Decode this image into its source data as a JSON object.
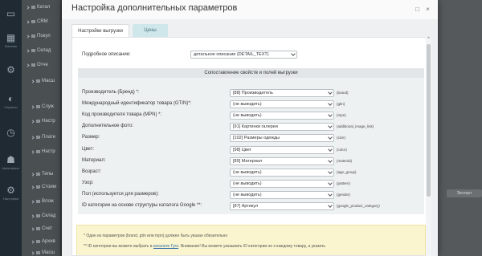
{
  "background": {
    "sidebar_items": [
      {
        "icon": "desktop-icon",
        "glyph": "▭",
        "label": ""
      },
      {
        "icon": "shop-icon",
        "glyph": "▦",
        "label": "Магазин"
      },
      {
        "icon": "gear-icon",
        "glyph": "⚙",
        "label": ""
      },
      {
        "icon": "services-icon",
        "glyph": "◐",
        "label": "Сервисы"
      },
      {
        "icon": "analytics-icon",
        "glyph": "◷",
        "label": ""
      },
      {
        "icon": "marketplace-icon",
        "glyph": "☗",
        "label": "Marketplace"
      },
      {
        "icon": "settings-icon",
        "glyph": "⚙",
        "label": "Настройки"
      }
    ],
    "tree_items": [
      "Катал",
      "CRM",
      "Покуп",
      "Склад",
      "Отче",
      "Масш",
      "Служ",
      "Настр",
      "Плате",
      "Настр",
      "Типы",
      "Стоим",
      "Влож",
      "Склад",
      "Счет",
      "Архив",
      "Масш"
    ],
    "right_button": "Экспорт"
  },
  "dialog": {
    "title": "Настройка дополнительных параметров",
    "minimize_glyph": "□",
    "close_glyph": "×",
    "tabs": [
      {
        "label": "Настройки выгрузки",
        "active": true
      },
      {
        "label": "Цены",
        "active": false
      }
    ],
    "detail_description": {
      "label": "Подробное описание:",
      "value": "детальное описание (DETAIL_TEXT)"
    },
    "mapping_section_title": "Сопоставление свойств и полей выгрузки",
    "mapping_rows": [
      {
        "label": "Производитель (Бренд) *:",
        "value": "[88] Производитель",
        "hint": "(brand)"
      },
      {
        "label": "Международный идентификатор товара (GTIN)*:",
        "value": "(не выводить)",
        "hint": "(gtin)"
      },
      {
        "label": "Код производителя товара (MPN) *:",
        "value": "(не выводить)",
        "hint": "(mpn)"
      },
      {
        "label": "Дополнительное фото:",
        "value": "[91] Картинки галереи",
        "hint": "(additional_image_link)"
      },
      {
        "label": "Размер:",
        "value": "[102] Размеры одежды",
        "hint": "(size)"
      },
      {
        "label": "Цвет:",
        "value": "[98] Цвет",
        "hint": "(color)"
      },
      {
        "label": "Материал:",
        "value": "[89] Материал",
        "hint": "(material)"
      },
      {
        "label": "Возраст:",
        "value": "(не выводить)",
        "hint": "(age_group)"
      },
      {
        "label": "Узор:",
        "value": "(не выводить)",
        "hint": "(pattern)"
      },
      {
        "label": "Пол (используется для размеров):",
        "value": "(не выводить)",
        "hint": "(gender)"
      },
      {
        "label": "ID категории на основе структуры каталога Google **:",
        "value": "[87] Артикул",
        "hint": "(google_product_category)"
      }
    ],
    "note": {
      "line1": "* Один из параметров (brand, gtin или mpn) должен быть указан обязательно",
      "line2_prefix": "** ID категории вы можете выбрать в",
      "line2_link": "каталоге Гугл",
      "line2_suffix": ". Внимание! Вы можете указывать ID категории не к каждому товару, а указать"
    },
    "scroll_up_glyph": "^"
  }
}
